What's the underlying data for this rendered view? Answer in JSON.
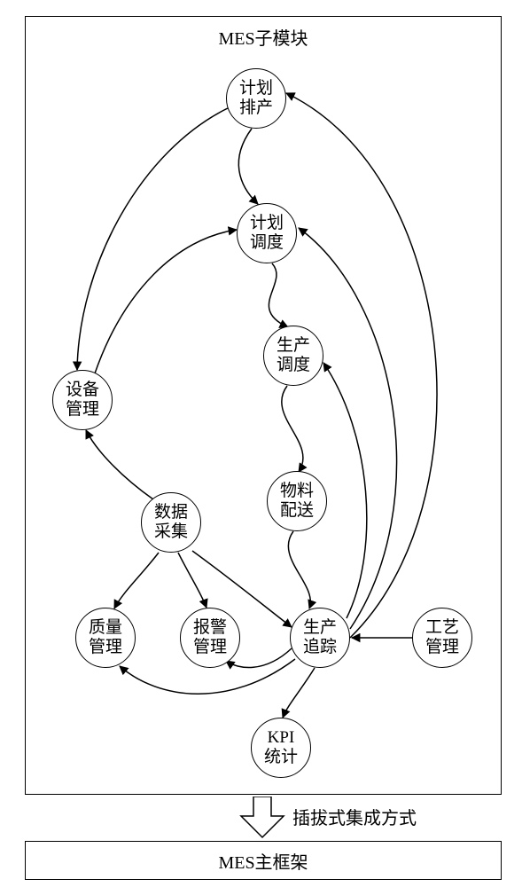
{
  "container_title": "MES子模块",
  "integration_label": "插拔式集成方式",
  "bottom_box": "MES主框架",
  "nodes": {
    "plan_schedule": "计划\n排产",
    "plan_dispatch": "计划\n调度",
    "prod_dispatch": "生产\n调度",
    "equip_mgmt": "设备\n管理",
    "data_collect": "数据\n采集",
    "material_deliver": "物料\n配送",
    "quality_mgmt": "质量\n管理",
    "alarm_mgmt": "报警\n管理",
    "prod_trace": "生产\n追踪",
    "process_mgmt": "工艺\n管理",
    "kpi_stat": "KPI\n统计"
  }
}
